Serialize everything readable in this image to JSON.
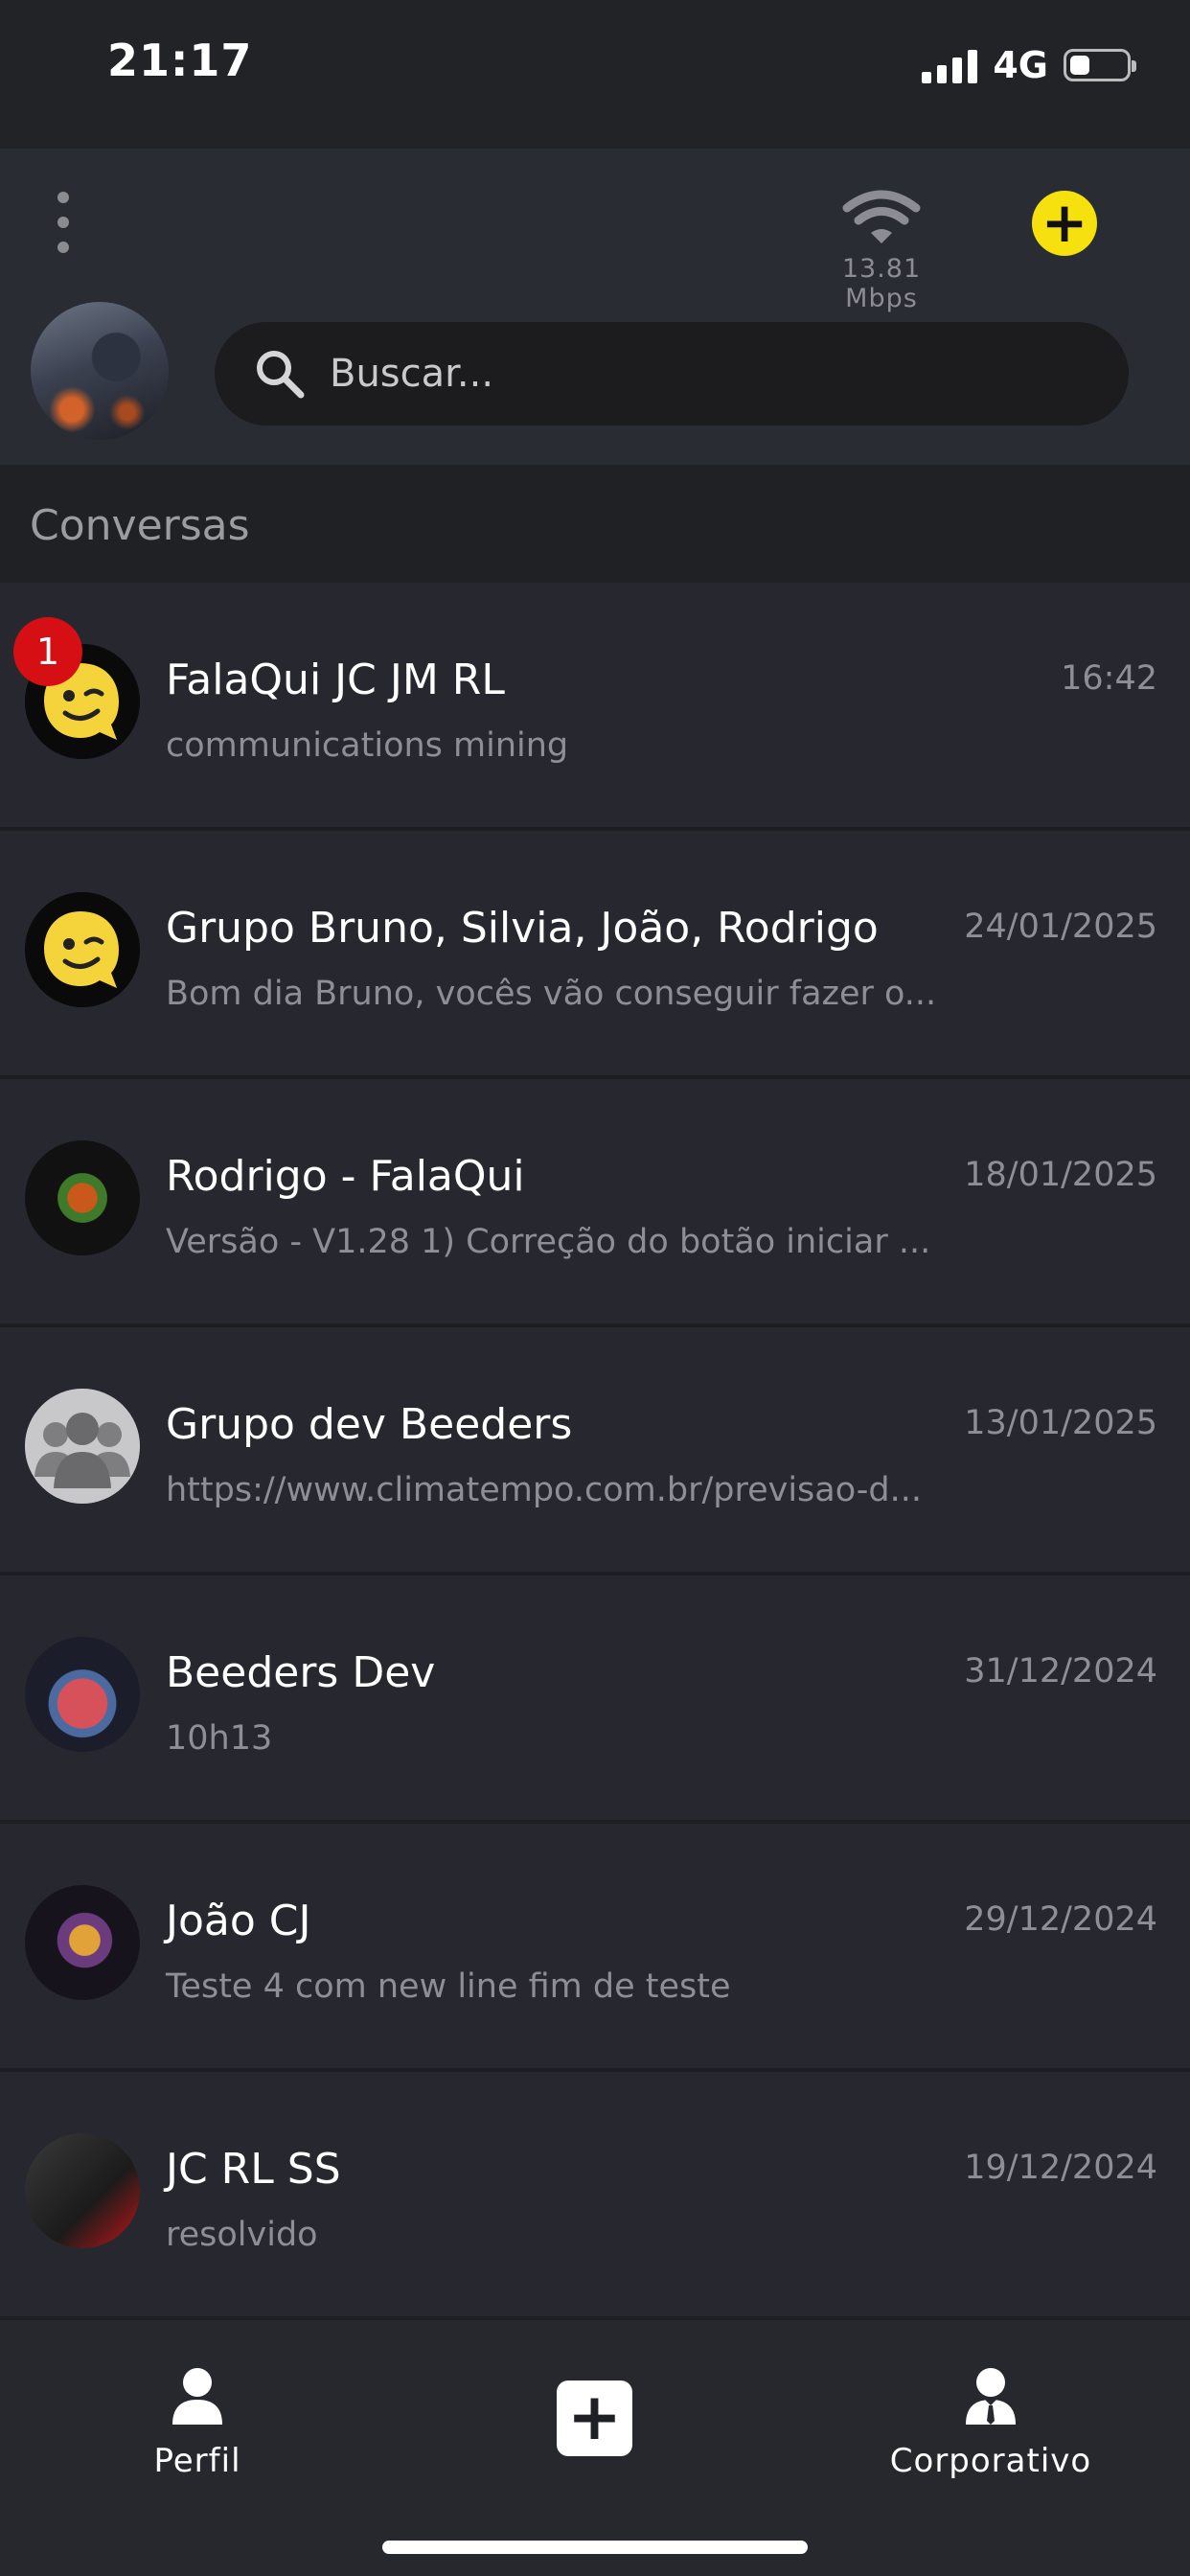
{
  "status_bar": {
    "time": "21:17",
    "network": "4G",
    "battery_level": 0.35
  },
  "header": {
    "wifi_speed": "13.81 Mbps",
    "search": {
      "placeholder": "Buscar..."
    }
  },
  "section_title": "Conversas",
  "conversations": [
    {
      "name": "FalaQui JC JM RL",
      "preview": "communications mining",
      "time": "16:42",
      "unread": "1",
      "avatar": "wink-emoji-icon"
    },
    {
      "name": "Grupo Bruno, Silvia, João, Rodrigo",
      "preview": "Bom dia Bruno, vocês vão conseguir fazer o...",
      "time": "24/01/2025",
      "avatar": "wink-emoji-icon"
    },
    {
      "name": "Rodrigo - FalaQui",
      "preview": "Versão - V1.28 1) Correção do botão iniciar ...",
      "time": "18/01/2025",
      "avatar": "tiger-photo"
    },
    {
      "name": "Grupo dev Beeders",
      "preview": "https://www.climatempo.com.br/previsao-d...",
      "time": "13/01/2025",
      "avatar": "group-icon"
    },
    {
      "name": "Beeders Dev",
      "preview": "10h13",
      "time": "31/12/2024",
      "avatar": "apple-photo"
    },
    {
      "name": "João CJ",
      "preview": "Teste 4 com new line fim de teste",
      "time": "29/12/2024",
      "avatar": "robot-photo"
    },
    {
      "name": "JC RL SS",
      "preview": "resolvido",
      "time": "19/12/2024",
      "avatar": "poster-photo"
    }
  ],
  "bottom_nav": {
    "profile_label": "Perfil",
    "corporate_label": "Corporativo"
  }
}
